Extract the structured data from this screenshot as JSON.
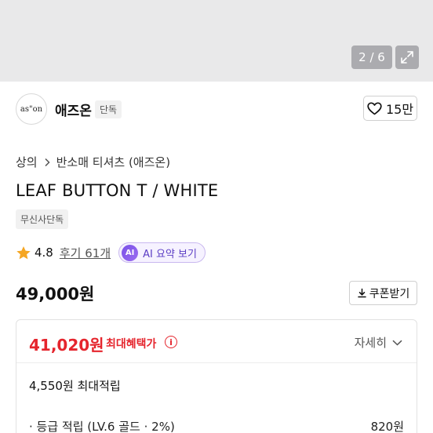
{
  "gallery": {
    "counter": "2 / 6"
  },
  "brand": {
    "logo_text": "as\"on",
    "name": "애즈온",
    "tag": "단독",
    "like_count": "15만"
  },
  "breadcrumb": {
    "level1": "상의",
    "level2": "반소매 티셔츠 (애즈온)"
  },
  "product": {
    "title": "LEAF BUTTON T / WHITE",
    "exclusive_tag": "무신사단독",
    "rating": "4.8",
    "reviews": "후기 61개",
    "ai_badge": "AI",
    "ai_label": "AI 요약 보기",
    "price": "49,000원",
    "coupon_label": "쿠폰받기"
  },
  "benefit": {
    "sale_price": "41,020원",
    "sale_label": "최대혜택가",
    "detail_label": "자세히",
    "points_total": "4,550원 최대적립",
    "rows": [
      {
        "label": "· 등급 적립 (LV.6 골드 · 2%)",
        "value": "820원"
      }
    ]
  },
  "colors": {
    "accent_red": "#e5252d",
    "ai_purple": "#7a52e8",
    "star": "#f5a623"
  },
  "icons": [
    "expand-icon",
    "heart-icon",
    "chevron-right-icon",
    "star-icon",
    "download-icon",
    "info-icon",
    "chevron-down-icon"
  ]
}
